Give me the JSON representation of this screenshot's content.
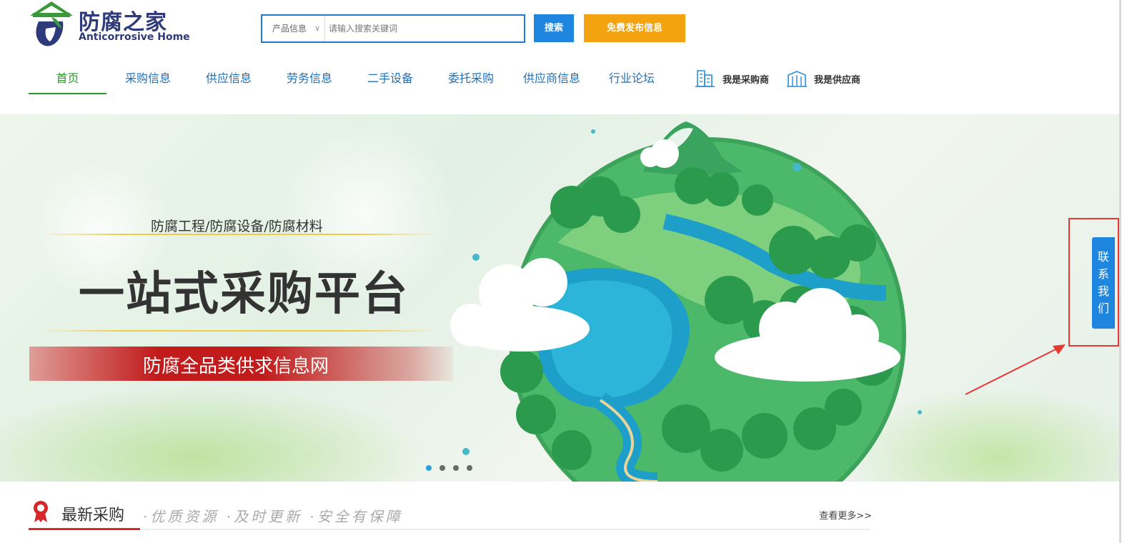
{
  "logo": {
    "cn": "防腐之家",
    "en": "Anticorrosive Home"
  },
  "search": {
    "category": "产品信息",
    "placeholder": "请输入搜索关键词",
    "button": "搜索"
  },
  "publish_button": "免费发布信息",
  "nav": [
    "首页",
    "采购信息",
    "供应信息",
    "劳务信息",
    "二手设备",
    "委托采购",
    "供应商信息",
    "行业论坛"
  ],
  "roles": {
    "buyer": "我是采购商",
    "supplier": "我是供应商"
  },
  "banner": {
    "subtitle": "防腐工程/防腐设备/防腐材料",
    "title": "一站式采购平台",
    "tagline": "防腐全品类供求信息网",
    "slide_count": 4,
    "active_slide": 1
  },
  "contact": "联系我们",
  "section": {
    "title": "最新采购",
    "slogan": "·优质资源 ·及时更新 ·安全有保障",
    "more": "查看更多>>"
  },
  "colors": {
    "brand_blue": "#1f86e0",
    "publish_orange": "#f2a30f",
    "nav_active_green": "#2c9a2a",
    "highlight_red": "#e53935"
  }
}
